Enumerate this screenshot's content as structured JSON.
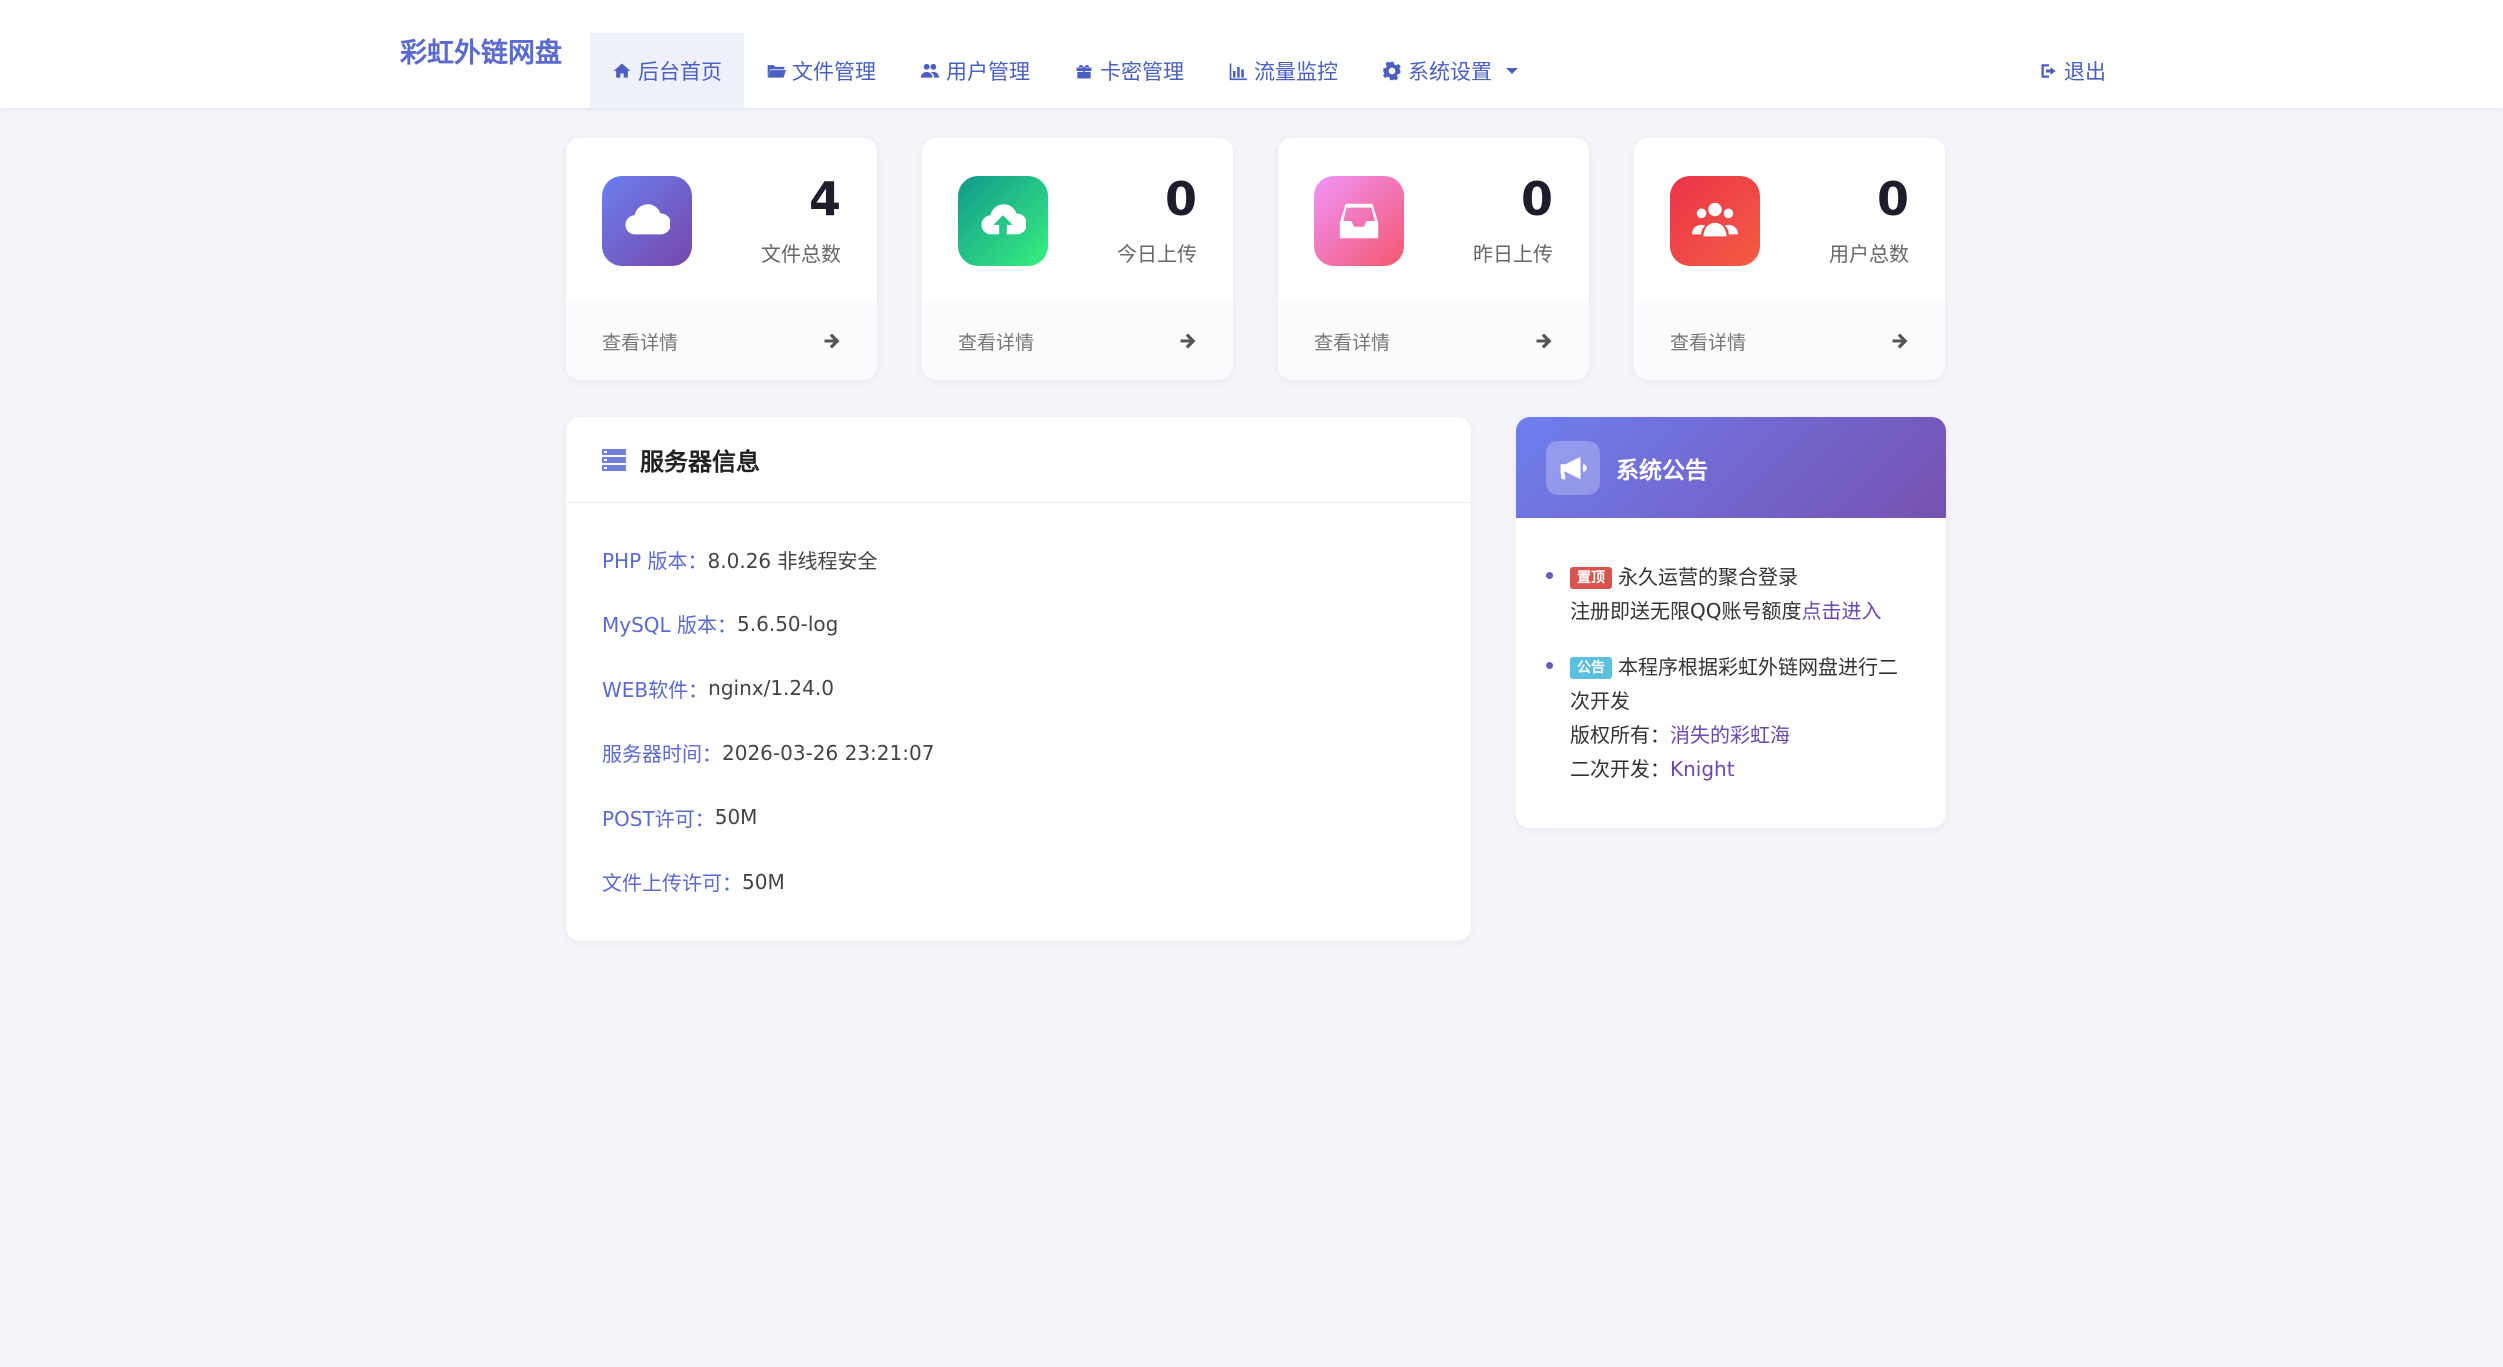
{
  "brand": "彩虹外链网盘",
  "nav": {
    "items": [
      {
        "label": "后台首页",
        "icon": "home-icon",
        "active": true
      },
      {
        "label": "文件管理",
        "icon": "folder-icon",
        "active": false
      },
      {
        "label": "用户管理",
        "icon": "users-icon",
        "active": false
      },
      {
        "label": "卡密管理",
        "icon": "gift-icon",
        "active": false
      },
      {
        "label": "流量监控",
        "icon": "bar-chart-icon",
        "active": false
      },
      {
        "label": "系统设置",
        "icon": "gear-icon",
        "active": false,
        "dropdown": true
      }
    ],
    "logout": "退出"
  },
  "stats": [
    {
      "value": "4",
      "label": "文件总数",
      "footer": "查看详情",
      "icon": "cloud-icon",
      "gradient": [
        "#6a7ff0",
        "#7646a9"
      ]
    },
    {
      "value": "0",
      "label": "今日上传",
      "footer": "查看详情",
      "icon": "cloud-upload-icon",
      "gradient": [
        "#11998e",
        "#38ef7d"
      ]
    },
    {
      "value": "0",
      "label": "昨日上传",
      "footer": "查看详情",
      "icon": "inbox-icon",
      "gradient": [
        "#f093fb",
        "#f5576c"
      ]
    },
    {
      "value": "0",
      "label": "用户总数",
      "footer": "查看详情",
      "icon": "users-icon",
      "gradient": [
        "#eb3349",
        "#f45c43"
      ]
    }
  ],
  "server": {
    "title": "服务器信息",
    "rows": [
      {
        "key": "PHP 版本：",
        "value": "8.0.26 非线程安全"
      },
      {
        "key": "MySQL 版本：",
        "value": "5.6.50-log"
      },
      {
        "key": "WEB软件：",
        "value": "nginx/1.24.0"
      },
      {
        "key": "服务器时间：",
        "value": "2026-03-26 23:21:07"
      },
      {
        "key": "POST许可：",
        "value": "50M"
      },
      {
        "key": "文件上传许可：",
        "value": "50M"
      }
    ]
  },
  "notice": {
    "title": "系统公告",
    "items": [
      {
        "badge": "置顶",
        "text": "永久运营的聚合登录",
        "line2": "注册即送无限QQ账号额度",
        "link": "点击进入"
      },
      {
        "badge": "公告",
        "text": "本程序根据彩虹外链网盘进行二次开发",
        "copyright_label": "版权所有：",
        "copyright_link": "消失的彩虹海",
        "dev_label": "二次开发：",
        "dev_link": "Knight"
      }
    ]
  },
  "colors": {
    "accent": "#5b6ad0",
    "background": "#f4f5fa"
  }
}
